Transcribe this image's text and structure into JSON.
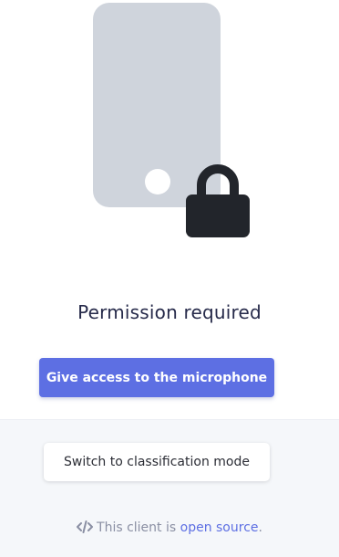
{
  "icons": {
    "phone": "phone-icon",
    "lock": "lock-icon",
    "code": "code-icon"
  },
  "colors": {
    "accent": "#5d6fe3",
    "phone": "#cfd4dc",
    "lock": "#22252b",
    "title": "#262a4a",
    "footer_text": "#8a8fa3",
    "bottom_background": "#f5f7fa"
  },
  "main": {
    "title": "Permission required",
    "primary_button_label": "Give access to the microphone"
  },
  "bottom": {
    "secondary_button_label": "Switch to classification mode",
    "footer": {
      "prefix": "This client is",
      "link_text": "open source",
      "suffix": "."
    }
  }
}
